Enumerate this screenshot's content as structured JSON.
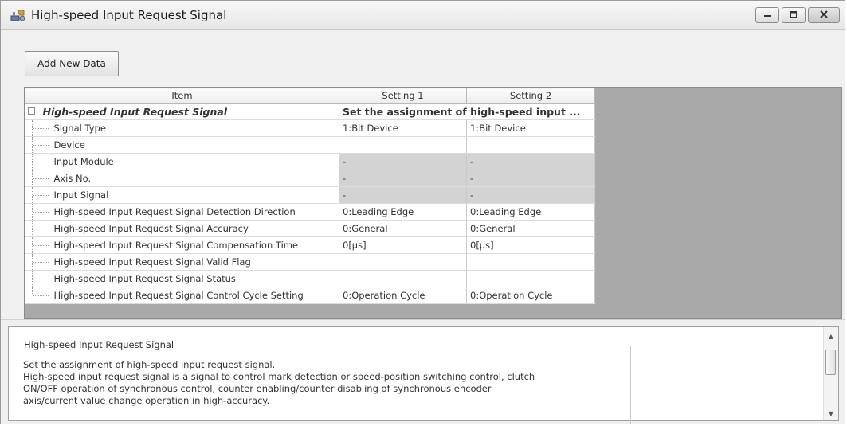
{
  "window": {
    "title": "High-speed Input Request Signal"
  },
  "toolbar": {
    "add_new_data_label": "Add New Data"
  },
  "grid": {
    "headers": [
      "Item",
      "Setting 1",
      "Setting 2"
    ],
    "group": {
      "label": "High-speed Input Request Signal",
      "setting": "Set the assignment of high-speed input ..."
    },
    "rows": [
      {
        "item": "Signal Type",
        "s1": "1:Bit Device",
        "s2": "1:Bit Device"
      },
      {
        "item": "Device",
        "s1": "",
        "s2": ""
      },
      {
        "item": "Input Module",
        "s1": "-",
        "s2": "-"
      },
      {
        "item": "Axis No.",
        "s1": "-",
        "s2": "-"
      },
      {
        "item": "Input Signal",
        "s1": "-",
        "s2": "-"
      },
      {
        "item": "High-speed Input Request Signal Detection Direction",
        "s1": "0:Leading Edge",
        "s2": "0:Leading Edge"
      },
      {
        "item": "High-speed Input Request Signal Accuracy",
        "s1": "0:General",
        "s2": "0:General"
      },
      {
        "item": "High-speed Input Request Signal Compensation Time",
        "s1": "0[µs]",
        "s2": "0[µs]"
      },
      {
        "item": "High-speed Input Request Signal Valid Flag",
        "s1": "",
        "s2": ""
      },
      {
        "item": "High-speed Input Request Signal Status",
        "s1": "",
        "s2": ""
      },
      {
        "item": "High-speed Input Request Signal Control Cycle Setting",
        "s1": "0:Operation Cycle",
        "s2": "0:Operation Cycle"
      }
    ]
  },
  "description": {
    "title": "High-speed Input Request Signal",
    "lines": [
      "Set the assignment of high-speed input request signal.",
      "High-speed input request signal is a signal to control mark detection or speed-position switching control, clutch",
      "ON/OFF operation of synchronous control, counter enabling/counter disabling of synchronous encoder",
      "axis/current value change operation in high-accuracy."
    ]
  },
  "icons": {
    "app": "settings-app-icon",
    "minimize": "minimize-icon",
    "maximize": "maximize-icon",
    "close": "close-icon",
    "collapse": "collapse-minus-icon"
  },
  "colors": {
    "disabled_cell": "#d3d3d3",
    "grid_background": "#a9a9a9"
  }
}
